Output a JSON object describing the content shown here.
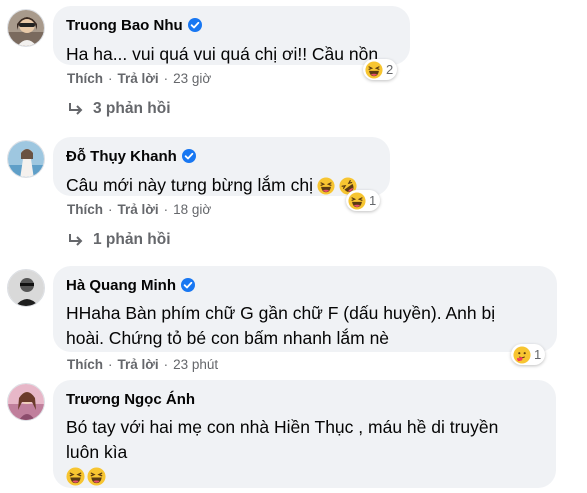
{
  "labels": {
    "like": "Thích",
    "reply": "Trả lời",
    "sep": "·"
  },
  "colors": {
    "bubble": "#f0f2f5",
    "meta": "#65676b",
    "verified": "#1877f2"
  },
  "comments": [
    {
      "name": "Truong Bao Nhu",
      "verified": true,
      "lines": [
        "Ha ha... vui quá vui quá chị ơi!! Cầu nồn"
      ],
      "time": "23 giờ",
      "reaction_icons": [
        "haha-icon"
      ],
      "reaction_count": "2",
      "replies": "3 phản hồi"
    },
    {
      "name": "Đỗ Thụy Khanh",
      "verified": true,
      "lines": [
        "Câu mới này tưng bừng lắm chị"
      ],
      "inline_emoji": [
        "laughing-emoji",
        "rofl-emoji"
      ],
      "time": "18 giờ",
      "reaction_icons": [
        "haha-icon"
      ],
      "reaction_count": "1",
      "replies": "1 phản hồi"
    },
    {
      "name": "Hà Quang Minh",
      "verified": true,
      "lines": [
        "HHaha Bàn phím chữ G gần chữ F (dấu huyền). Anh bị",
        "hoài. Chứng tỏ bé con bấm nhanh lắm nè"
      ],
      "time": "23 phút",
      "reaction_icons": [
        "care-icon"
      ],
      "reaction_count": "1"
    },
    {
      "name": "Trương Ngọc Ánh",
      "verified": false,
      "lines": [
        "Bó tay với hai mẹ con nhà Hiền Thục , máu hề di truyền",
        "luôn kìa"
      ],
      "inline_emoji": [
        "laughing-emoji",
        "laughing-emoji"
      ]
    }
  ]
}
